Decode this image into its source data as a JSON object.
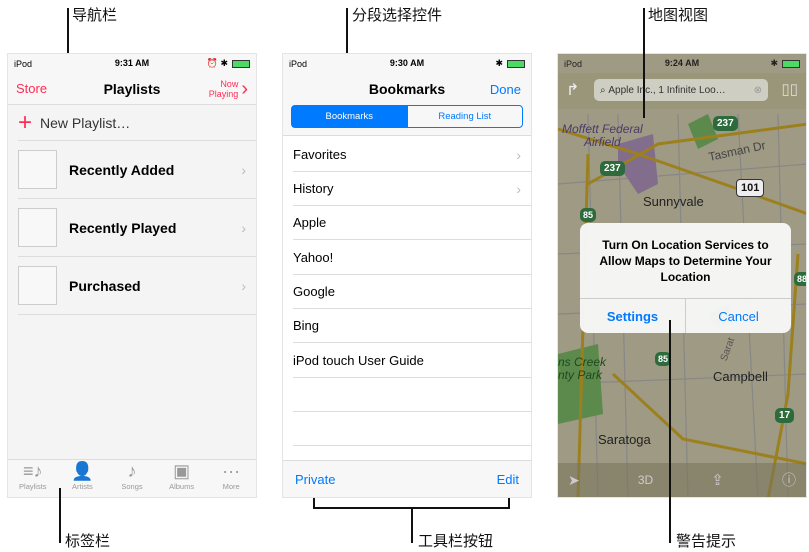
{
  "annotations": {
    "nav_bar": "导航栏",
    "segmented": "分段选择控件",
    "map_view": "地图视图",
    "tab_bar": "标签栏",
    "toolbar_buttons": "工具栏按钮",
    "alert": "警告提示"
  },
  "colors": {
    "accent_music": "#ff2d55",
    "accent_ios": "#007aff",
    "battery": "#4cd964"
  },
  "music": {
    "status": {
      "carrier": "iPod",
      "time": "9:31 AM"
    },
    "nav": {
      "left": "Store",
      "title": "Playlists",
      "right_line1": "Now",
      "right_line2": "Playing"
    },
    "new_playlist": "New Playlist…",
    "playlists": [
      "Recently Added",
      "Recently Played",
      "Purchased"
    ],
    "tabs": [
      {
        "label": "Playlists",
        "icon": "playlists-icon",
        "active": true
      },
      {
        "label": "Artists",
        "icon": "artists-icon"
      },
      {
        "label": "Songs",
        "icon": "songs-icon"
      },
      {
        "label": "Albums",
        "icon": "albums-icon"
      },
      {
        "label": "More",
        "icon": "more-icon"
      }
    ]
  },
  "safari": {
    "status": {
      "carrier": "iPod",
      "time": "9:30 AM"
    },
    "nav": {
      "title": "Bookmarks",
      "right": "Done"
    },
    "segments": [
      {
        "label": "Bookmarks",
        "selected": true
      },
      {
        "label": "Reading List",
        "selected": false
      }
    ],
    "items": [
      {
        "label": "Favorites",
        "folder": true
      },
      {
        "label": "History",
        "folder": true
      },
      {
        "label": "Apple"
      },
      {
        "label": "Yahoo!"
      },
      {
        "label": "Google"
      },
      {
        "label": "Bing"
      },
      {
        "label": "iPod touch User Guide"
      }
    ],
    "toolbar": {
      "left": "Private",
      "right": "Edit"
    }
  },
  "maps": {
    "status": {
      "carrier": "iPod",
      "time": "9:24 AM"
    },
    "search_value": "Apple Inc., 1 Infinite Loo…",
    "labels": {
      "moffett1": "Moffett Federal",
      "moffett2": "Airfield",
      "tasman": "Tasman Dr",
      "sunnyvale": "Sunnyvale",
      "creek1": "ns Creek",
      "creek2": "nty Park",
      "campbell": "Campbell",
      "saratoga": "Saratoga",
      "saratoga_rd": "Sarat"
    },
    "shields": {
      "h237": "237",
      "h101": "101",
      "h85": "85",
      "h17": "17",
      "h88": "88"
    },
    "toolbar": {
      "threed": "3D"
    },
    "alert": {
      "title": "Turn On Location Services to Allow Maps to Determine Your Location",
      "buttons": [
        "Settings",
        "Cancel"
      ]
    }
  }
}
